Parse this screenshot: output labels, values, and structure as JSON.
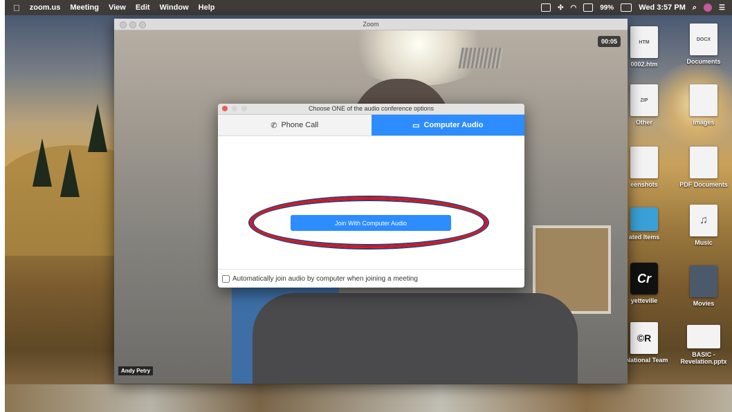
{
  "menubar": {
    "app_name": "zoom.us",
    "menus": [
      "Meeting",
      "View",
      "Edit",
      "Window",
      "Help"
    ],
    "battery": "99%",
    "clock": "Wed 3:57 PM"
  },
  "desktop_icons": [
    {
      "label": "0002.htm",
      "badge": "HTM"
    },
    {
      "label": "Documents",
      "badge": "DOCX"
    },
    {
      "label": "Other",
      "badge": "ZIP"
    },
    {
      "label": "Images",
      "badge": ""
    },
    {
      "label": "eenshots",
      "badge": ""
    },
    {
      "label": "PDF Documents",
      "badge": ""
    },
    {
      "label": "ated Items",
      "badge": ""
    },
    {
      "label": "Music",
      "badge": "♫"
    },
    {
      "label": "yetteville",
      "badge": "Cr"
    },
    {
      "label": "Movies",
      "badge": ""
    },
    {
      "label": "g National Team",
      "badge": "©R"
    },
    {
      "label": "BASIC - Revelation.pptx",
      "badge": ""
    }
  ],
  "zoom_window": {
    "title": "Zoom",
    "timer": "00:05",
    "participant_name": "Andy Petry"
  },
  "audio_dialog": {
    "title": "Choose ONE of the audio conference options",
    "tabs": [
      {
        "label": "Phone Call",
        "icon": "phone-icon",
        "active": false
      },
      {
        "label": "Computer Audio",
        "icon": "laptop-icon",
        "active": true
      }
    ],
    "join_button": "Join With Computer Audio",
    "auto_join_label": "Automatically join audio by computer when joining a meeting",
    "auto_join_checked": false
  },
  "colors": {
    "accent": "#2d8cff",
    "annotation_oval": "#d8151a"
  }
}
